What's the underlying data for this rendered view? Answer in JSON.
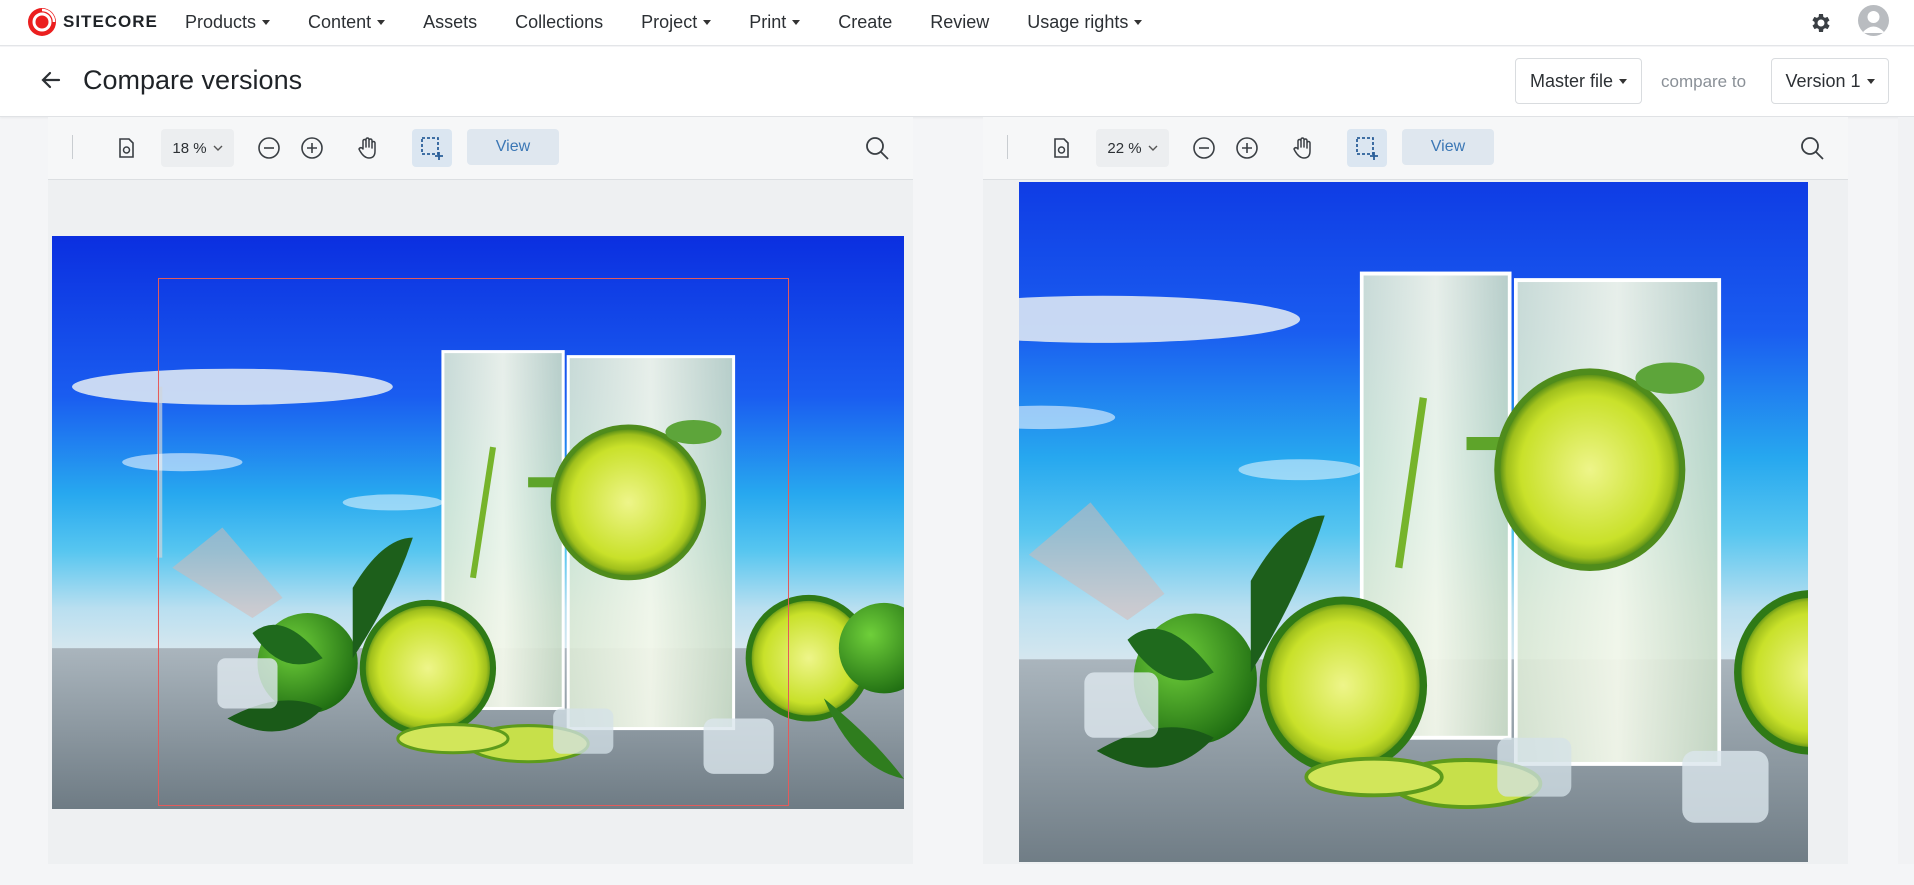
{
  "brand": {
    "name": "SITECORE",
    "accent": "#eb1f1f"
  },
  "nav": {
    "items": [
      {
        "label": "Products",
        "dropdown": true
      },
      {
        "label": "Content",
        "dropdown": true
      },
      {
        "label": "Assets",
        "dropdown": false
      },
      {
        "label": "Collections",
        "dropdown": false
      },
      {
        "label": "Project",
        "dropdown": true
      },
      {
        "label": "Print",
        "dropdown": true
      },
      {
        "label": "Create",
        "dropdown": false
      },
      {
        "label": "Review",
        "dropdown": false
      },
      {
        "label": "Usage rights",
        "dropdown": true
      }
    ]
  },
  "header": {
    "title": "Compare versions",
    "master_label": "Master file",
    "compare_to": "compare to",
    "version_label": "Version 1"
  },
  "left_viewer": {
    "zoom": "18 %",
    "view_label": "View"
  },
  "right_viewer": {
    "zoom": "22 %",
    "view_label": "View"
  },
  "icons": {
    "back": "arrow-left-icon",
    "settings": "gear-icon",
    "user": "user-avatar-icon",
    "fit": "fit-page-icon",
    "zoom_out": "zoom-out-icon",
    "zoom_in": "zoom-in-icon",
    "pan": "hand-icon",
    "select": "select-area-icon",
    "search": "search-icon"
  }
}
